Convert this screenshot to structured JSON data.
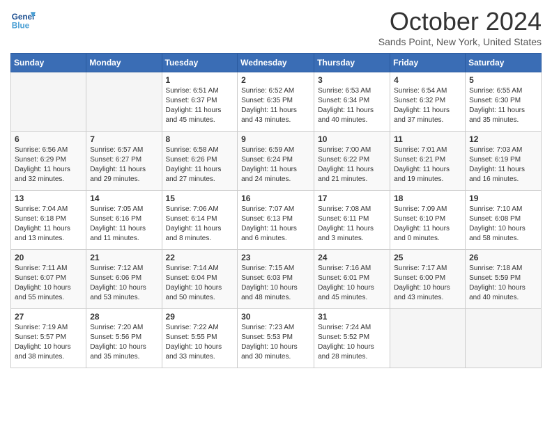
{
  "header": {
    "logo_general": "General",
    "logo_blue": "Blue",
    "month": "October 2024",
    "location": "Sands Point, New York, United States"
  },
  "days_of_week": [
    "Sunday",
    "Monday",
    "Tuesday",
    "Wednesday",
    "Thursday",
    "Friday",
    "Saturday"
  ],
  "weeks": [
    [
      {
        "day": "",
        "info": ""
      },
      {
        "day": "",
        "info": ""
      },
      {
        "day": "1",
        "info": "Sunrise: 6:51 AM\nSunset: 6:37 PM\nDaylight: 11 hours and 45 minutes."
      },
      {
        "day": "2",
        "info": "Sunrise: 6:52 AM\nSunset: 6:35 PM\nDaylight: 11 hours and 43 minutes."
      },
      {
        "day": "3",
        "info": "Sunrise: 6:53 AM\nSunset: 6:34 PM\nDaylight: 11 hours and 40 minutes."
      },
      {
        "day": "4",
        "info": "Sunrise: 6:54 AM\nSunset: 6:32 PM\nDaylight: 11 hours and 37 minutes."
      },
      {
        "day": "5",
        "info": "Sunrise: 6:55 AM\nSunset: 6:30 PM\nDaylight: 11 hours and 35 minutes."
      }
    ],
    [
      {
        "day": "6",
        "info": "Sunrise: 6:56 AM\nSunset: 6:29 PM\nDaylight: 11 hours and 32 minutes."
      },
      {
        "day": "7",
        "info": "Sunrise: 6:57 AM\nSunset: 6:27 PM\nDaylight: 11 hours and 29 minutes."
      },
      {
        "day": "8",
        "info": "Sunrise: 6:58 AM\nSunset: 6:26 PM\nDaylight: 11 hours and 27 minutes."
      },
      {
        "day": "9",
        "info": "Sunrise: 6:59 AM\nSunset: 6:24 PM\nDaylight: 11 hours and 24 minutes."
      },
      {
        "day": "10",
        "info": "Sunrise: 7:00 AM\nSunset: 6:22 PM\nDaylight: 11 hours and 21 minutes."
      },
      {
        "day": "11",
        "info": "Sunrise: 7:01 AM\nSunset: 6:21 PM\nDaylight: 11 hours and 19 minutes."
      },
      {
        "day": "12",
        "info": "Sunrise: 7:03 AM\nSunset: 6:19 PM\nDaylight: 11 hours and 16 minutes."
      }
    ],
    [
      {
        "day": "13",
        "info": "Sunrise: 7:04 AM\nSunset: 6:18 PM\nDaylight: 11 hours and 13 minutes."
      },
      {
        "day": "14",
        "info": "Sunrise: 7:05 AM\nSunset: 6:16 PM\nDaylight: 11 hours and 11 minutes."
      },
      {
        "day": "15",
        "info": "Sunrise: 7:06 AM\nSunset: 6:14 PM\nDaylight: 11 hours and 8 minutes."
      },
      {
        "day": "16",
        "info": "Sunrise: 7:07 AM\nSunset: 6:13 PM\nDaylight: 11 hours and 6 minutes."
      },
      {
        "day": "17",
        "info": "Sunrise: 7:08 AM\nSunset: 6:11 PM\nDaylight: 11 hours and 3 minutes."
      },
      {
        "day": "18",
        "info": "Sunrise: 7:09 AM\nSunset: 6:10 PM\nDaylight: 11 hours and 0 minutes."
      },
      {
        "day": "19",
        "info": "Sunrise: 7:10 AM\nSunset: 6:08 PM\nDaylight: 10 hours and 58 minutes."
      }
    ],
    [
      {
        "day": "20",
        "info": "Sunrise: 7:11 AM\nSunset: 6:07 PM\nDaylight: 10 hours and 55 minutes."
      },
      {
        "day": "21",
        "info": "Sunrise: 7:12 AM\nSunset: 6:06 PM\nDaylight: 10 hours and 53 minutes."
      },
      {
        "day": "22",
        "info": "Sunrise: 7:14 AM\nSunset: 6:04 PM\nDaylight: 10 hours and 50 minutes."
      },
      {
        "day": "23",
        "info": "Sunrise: 7:15 AM\nSunset: 6:03 PM\nDaylight: 10 hours and 48 minutes."
      },
      {
        "day": "24",
        "info": "Sunrise: 7:16 AM\nSunset: 6:01 PM\nDaylight: 10 hours and 45 minutes."
      },
      {
        "day": "25",
        "info": "Sunrise: 7:17 AM\nSunset: 6:00 PM\nDaylight: 10 hours and 43 minutes."
      },
      {
        "day": "26",
        "info": "Sunrise: 7:18 AM\nSunset: 5:59 PM\nDaylight: 10 hours and 40 minutes."
      }
    ],
    [
      {
        "day": "27",
        "info": "Sunrise: 7:19 AM\nSunset: 5:57 PM\nDaylight: 10 hours and 38 minutes."
      },
      {
        "day": "28",
        "info": "Sunrise: 7:20 AM\nSunset: 5:56 PM\nDaylight: 10 hours and 35 minutes."
      },
      {
        "day": "29",
        "info": "Sunrise: 7:22 AM\nSunset: 5:55 PM\nDaylight: 10 hours and 33 minutes."
      },
      {
        "day": "30",
        "info": "Sunrise: 7:23 AM\nSunset: 5:53 PM\nDaylight: 10 hours and 30 minutes."
      },
      {
        "day": "31",
        "info": "Sunrise: 7:24 AM\nSunset: 5:52 PM\nDaylight: 10 hours and 28 minutes."
      },
      {
        "day": "",
        "info": ""
      },
      {
        "day": "",
        "info": ""
      }
    ]
  ]
}
